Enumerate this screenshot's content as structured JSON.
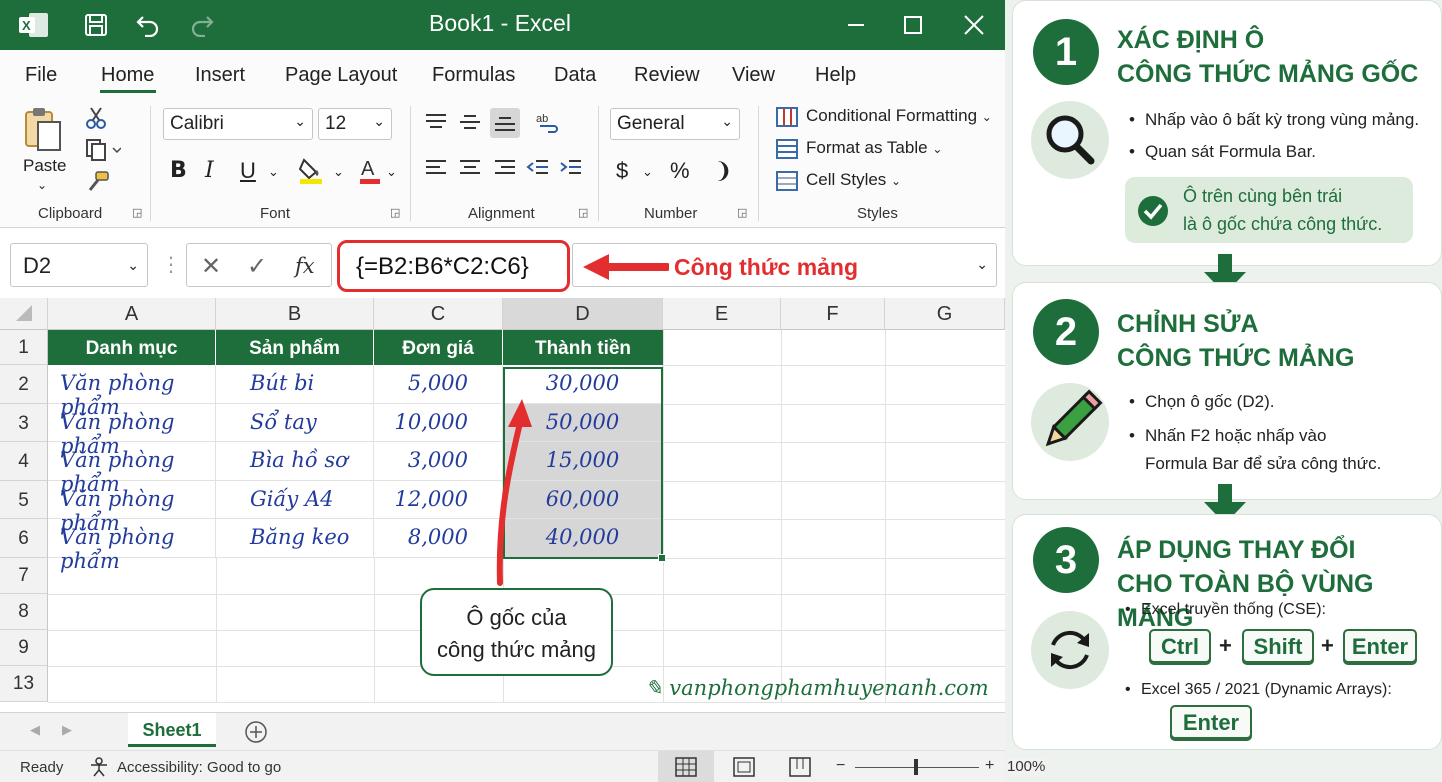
{
  "window": {
    "title": "Book1  -  Excel"
  },
  "menu": [
    "File",
    "Home",
    "Insert",
    "Page Layout",
    "Formulas",
    "Data",
    "Review",
    "View",
    "Help"
  ],
  "ribbon": {
    "paste_label": "Paste",
    "font_name": "Calibri",
    "font_size": "12",
    "number_format": "General",
    "bold": "B",
    "italic": "I",
    "underline": "U",
    "currency": "$",
    "percent": "%",
    "comma": "❩",
    "styles": [
      "Conditional Formatting",
      "Format as Table",
      "Cell Styles"
    ],
    "groups": [
      "Clipboard",
      "Font",
      "Alignment",
      "Number",
      "Styles"
    ]
  },
  "formula_bar": {
    "name_box": "D2",
    "fx": "fx",
    "formula": "{=B2:B6*C2:C6}",
    "annotation": "Công thức mảng"
  },
  "grid": {
    "columns": [
      "A",
      "B",
      "C",
      "D",
      "E",
      "F",
      "G"
    ],
    "rows": [
      "1",
      "2",
      "3",
      "4",
      "5",
      "6",
      "7",
      "8",
      "9",
      "13"
    ],
    "headers": [
      "Danh mục",
      "Sản phẩm",
      "Đơn giá",
      "Thành tiền"
    ],
    "data": [
      [
        "Văn phòng phẩm",
        "Bút bi",
        "5,000",
        "30,000"
      ],
      [
        "Văn phòng phẩm",
        "Sổ tay",
        "10,000",
        "50,000"
      ],
      [
        "Văn phòng phẩm",
        "Bìa hồ sơ",
        "3,000",
        "15,000"
      ],
      [
        "Văn phòng phẩm",
        "Giấy A4",
        "12,000",
        "60,000"
      ],
      [
        "Văn phòng phẩm",
        "Băng keo",
        "8,000",
        "40,000"
      ]
    ]
  },
  "callout": {
    "line1": "Ô gốc của",
    "line2": "công thức mảng"
  },
  "watermark": "vanphongphamhuyenanh.com",
  "sheet_tab": "Sheet1",
  "status": {
    "ready": "Ready",
    "accessibility": "Accessibility: Good to go",
    "zoom": "100%"
  },
  "colors": {
    "excel_green": "#1e6e3c",
    "annotation_red": "#e22e2e",
    "ink_blue": "#233c9c"
  },
  "steps": [
    {
      "number": "1",
      "title1": "XÁC ĐỊNH Ô",
      "title2": "CÔNG THỨC MẢNG GỐC",
      "icon": "magnifier-icon",
      "bullets": [
        "Nhấp vào ô bất kỳ trong vùng mảng.",
        "Quan sát Formula Bar."
      ],
      "tip1": "Ô trên cùng bên trái",
      "tip2": "là ô gốc chứa công thức."
    },
    {
      "number": "2",
      "title1": "CHỈNH SỬA",
      "title2": "CÔNG THỨC MẢNG",
      "icon": "pencil-icon",
      "bullets": [
        "Chọn ô gốc (D2).",
        "Nhấn F2 hoặc nhấp vào",
        "Formula Bar để sửa công thức."
      ]
    },
    {
      "number": "3",
      "title1": "ÁP DỤNG THAY ĐỔI",
      "title2": "CHO TOÀN BỘ VÙNG MẢNG",
      "icon": "refresh-icon",
      "bullets": [
        "Excel truyền thống (CSE):",
        "Excel 365 / 2021 (Dynamic Arrays):"
      ],
      "keys": [
        "Ctrl",
        "Shift",
        "Enter"
      ],
      "plus": "+",
      "key_enter": "Enter"
    }
  ]
}
